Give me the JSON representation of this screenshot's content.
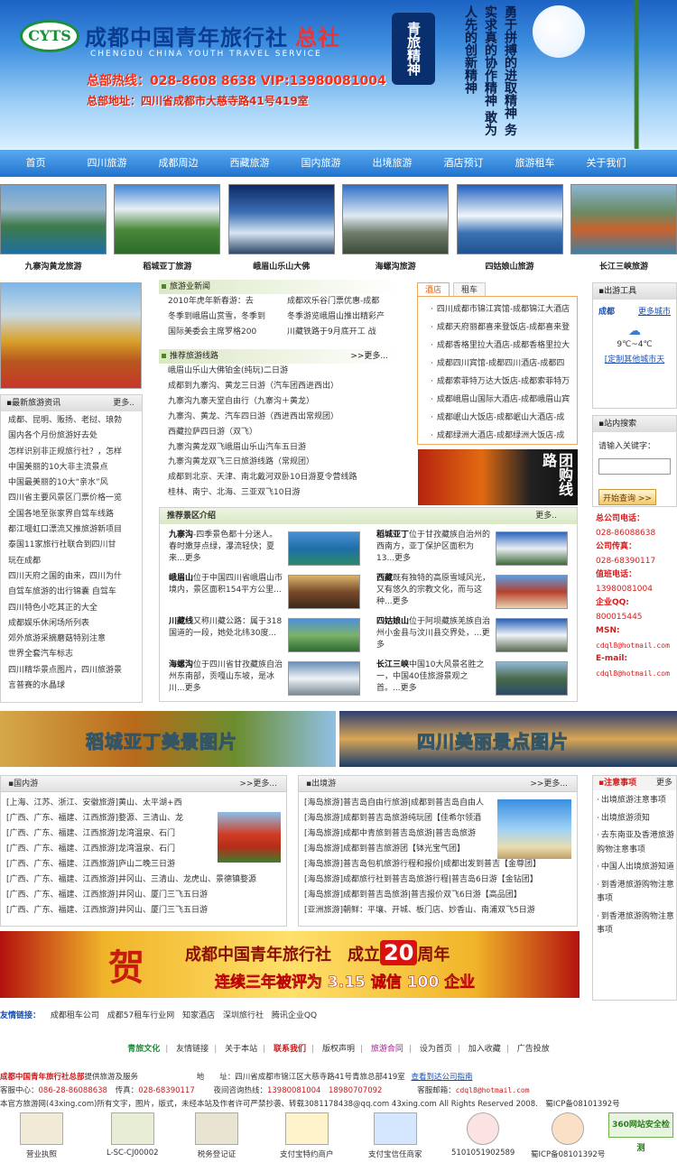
{
  "header": {
    "logo_text": "CYTS",
    "site_name": "成都中国青年旅行社",
    "site_hq": "总社",
    "site_en": "CHENGDU CHINA YOUTH TRAVEL SERVICE",
    "hotline": "总部热线：028-8608 8638 VIP:13980081004",
    "address": "总部地址：四川省成都市大慈寺路41号419室",
    "slogan_badge": "青旅精神",
    "slogan_text": "勇于拼搏的进取精神 务实求真的协作精神 敢为人先的创新精神"
  },
  "nav": [
    "首页",
    "四川旅游",
    "成都周边",
    "西藏旅游",
    "国内旅游",
    "出境旅游",
    "酒店预订",
    "旅游租车",
    "关于我们"
  ],
  "photos": [
    "九寨沟黄龙旅游",
    "稻城亚丁旅游",
    "峨眉山乐山大佛",
    "海螺沟旅游",
    "四姑娘山旅游",
    "长江三峡旅游"
  ],
  "latest": {
    "title": "最新旅游资讯",
    "more": "更多..",
    "items": [
      "成都、昆明、贩扬、老挝、琅勃",
      "国内各个月份旅游好去处",
      "怎样识别非正规旅行社？，怎样",
      "中国美丽的10大非主流景点",
      "中国最美丽的10大“亲水”风",
      "四川省主要风景区门票价格一览",
      "全国各地至张家界自驾车线路",
      "都江堰虹口漂流又推旅游新项目",
      "泰国11家旅行社联合到四川甘",
      "玩在成都",
      "四川天府之国的由来，四川为什",
      "自驾车旅游的出行锦囊 自驾车",
      "四川特色小吃其正的大全",
      "成都娱乐休闲场所列表",
      "郊外旅游采摘蘑菇特别注意",
      "世界全套汽车标志",
      "四川精华景点图片，四川旅游景",
      "言普赛的水晶球"
    ]
  },
  "news": {
    "title": "旅游业新闻",
    "left": [
      "2010年虎年新春游：去",
      "冬季到峨眉山赏雪，冬季到",
      "国际美委会主席罗格200"
    ],
    "right": [
      "成都欢乐谷门票优惠-成都",
      "冬季游览峨眉山推出精彩产",
      "川藏铁路于9月底开工 战"
    ]
  },
  "routes": {
    "title": "推荐旅游线路",
    "more": ">>更多...",
    "items": [
      "峨眉山乐山大佛铂金(纯玩)二日游",
      "成都到九寨沟、黄龙三日游（汽车团西进西出）",
      "九寨沟九寨天堂自由行（九寨沟＋黄龙）",
      "九寨沟、黄龙、汽车四日游（西进西出常规团）",
      "西藏拉萨四日游（双飞）",
      "九寨沟黄龙双飞峨眉山乐山汽车五日游",
      "九寨沟黄龙双飞三日旅游线路（常规团）",
      "成都到北京、天津、南北戴河双卧10日游夏令营线路",
      "桂林、南宁、北海、三亚双飞10日游"
    ]
  },
  "hotel": {
    "tabs": [
      "酒店",
      "租车"
    ],
    "items": [
      "四川成都市锦江宾馆-成都锦江大酒店",
      "成都天府丽都喜来登饭店-成都喜来登",
      "成都香格里拉大酒店-成都香格里拉大",
      "成都四川宾馆-成都四川酒店-成都四",
      "成都索菲特万达大饭店-成都索菲特万",
      "成都峨眉山国际大酒店-成都峨眉山宾",
      "成都岷山大饭店-成都岷山大酒店-成",
      "成都绿洲大酒店-成都绿洲大饭店-成"
    ]
  },
  "group_img_text": "团购线路",
  "tools": {
    "title": "出游工具",
    "city": "成都",
    "more": "更多城市",
    "temp": "9℃~4℃",
    "custom": "[定制其他城市天"
  },
  "search": {
    "title": "站内搜索",
    "label": "请输入关键字：",
    "button": "开始查询 >>"
  },
  "contact": {
    "phone_label": "总公司电话：",
    "phone": "028-86088638",
    "fax_label": "公司传真：",
    "fax": "028-68390117",
    "duty_label": "值班电话：",
    "duty": "13980081004",
    "qq_label": "企业QQ:",
    "qq": "800015445",
    "msn_label": "MSN:",
    "msn": "cdql8@hotmail.com",
    "email_label": "E-mail:",
    "email": "cdql8@hotmail.com"
  },
  "scenic": {
    "title": "推荐景区介绍",
    "more": "更多..",
    "items": [
      {
        "name": "九寨沟",
        "text": "-四季景色都十分迷人。春时嫩芽点绿，瀑流轻快；夏来...更多"
      },
      {
        "name": "稻城亚丁",
        "text": "位于甘孜藏族自治州的西南方，亚丁保护区面积为13...更多"
      },
      {
        "name": "峨眉山",
        "text": "位于中国四川省峨眉山市境内，景区面积154平方公里..."
      },
      {
        "name": "西藏",
        "text": "既有独特的高原雪域风光，又有悠久的宗教文化，而与这种...更多"
      },
      {
        "name": "川藏线",
        "text": "又称川藏公路：属于318国道的一段，她处北纬30度..."
      },
      {
        "name": "四姑娘山",
        "text": "位于阿坝藏族羌族自治州小金县与汶川县交界处，...更多"
      },
      {
        "name": "海螺沟",
        "text": "位于四川省甘孜藏族自治州东南部，贡嘎山东坡，是冰川...更多"
      },
      {
        "name": "长江三峡",
        "text": "中国10大风景名胜之一，中国40佳旅游景观之首。...更多"
      }
    ]
  },
  "banners": [
    "稻城亚丁美景图片",
    "四川美丽景点图片"
  ],
  "domestic": {
    "title": "国内游",
    "more": ">>更多...",
    "items": [
      "[上海、江苏、浙江、安徽旅游]黄山、太平湖+西",
      "[广西、广东、福建、江西旅游]婺源、三清山、龙",
      "[广西、广东、福建、江西旅游]龙湾温泉、石门",
      "[广西、广东、福建、江西旅游]龙湾温泉、石门",
      "[广西、广东、福建、江西旅游]庐山二晚三日游",
      "[广西、广东、福建、江西旅游]井冈山、三清山、龙虎山、景德镇婺源",
      "[广西、广东、福建、江西旅游]井冈山、厦门三飞五日游",
      "[广西、广东、福建、江西旅游]井冈山、厦门三飞五日游"
    ]
  },
  "outbound": {
    "title": "出境游",
    "more": ">>更多...",
    "items": [
      "[海岛旅游]普吉岛自由行旅游|成都到普吉岛自由人",
      "[海岛旅游]成都到普吉岛旅游纯玩团【佳希尔领酒",
      "[海岛旅游]成都中青旅到普吉岛旅游|普吉岛旅游",
      "[海岛旅游]成都到普吉旅游团【钵光宝气团】",
      "[海岛旅游]普吉岛包机旅游行程和报价|成都出发到普吉【金尊团】",
      "[海岛旅游]成都旅行社到普吉岛旅游行程|普吉岛6日游【金钻团】",
      "[海岛旅游]成都到普吉岛旅游|普吉报价双飞6日游【高品团】",
      "[亚洲旅游]朝鲜：平壤、开城、板门店、妙香山、南浦双飞5日游"
    ]
  },
  "notice": {
    "title": "注意事项",
    "more": "更多",
    "items": [
      "出境旅游注意事项",
      "出境旅游须知",
      "去东南亚及香港旅游购物注意事项",
      "中国人出境旅游知道",
      "到香港旅游购物注意事项",
      "到香港旅游购物注意事项"
    ]
  },
  "big_banner": {
    "he": "贺",
    "line1_pre": "成都中国青年旅行社　成立",
    "line1_num": "20",
    "line1_post": "周年",
    "line2": "连续三年被评为 3.15 诚信 100 企业"
  },
  "friendlinks": {
    "label": "友情链接：",
    "items": [
      "成都租车公司",
      "成都57租车行业网",
      "知家酒店",
      "深圳旅行社",
      "腾讯企业QQ"
    ]
  },
  "footer_nav": [
    "青旅文化",
    "友情链接",
    "关于本站",
    "联系我们",
    "版权声明",
    "旅游合同",
    "设为首页",
    "加入收藏",
    "广告投放"
  ],
  "footer": {
    "line1_company": "成都中国青年旅行社总部",
    "line1_text": "提供旅游及服务",
    "line1_addr": "地　　址：四川省成都市锦江区大慈寺路41号青旅总部419室",
    "line1_link": "查看到达公司指南",
    "line2_service": "客服中心：",
    "line2_service_val": "086-28-86088638",
    "line2_fax": "传真：",
    "line2_fax_val": "028-68390117",
    "line2_night": "夜间咨询热线：",
    "line2_night_val": "13980081004　18980707092",
    "line2_email": "客服邮箱：",
    "line2_email_val": "cdql8@hotmail.com",
    "line3": "本官方旅游网(43xing.com)所有文字，图片，版式，未经本站及作者许可严禁抄袭、转载3081178438@qq.com 43xing.com All Rights Reserved 2008.　蜀ICP备08101392号"
  },
  "badges": [
    "营业执照",
    "L-SC-CJ00002",
    "税务登记证",
    "支付宝特约商户",
    "支付宝信任商家",
    "5101051902589",
    "蜀ICP备08101392号",
    "360网站安全检测"
  ]
}
